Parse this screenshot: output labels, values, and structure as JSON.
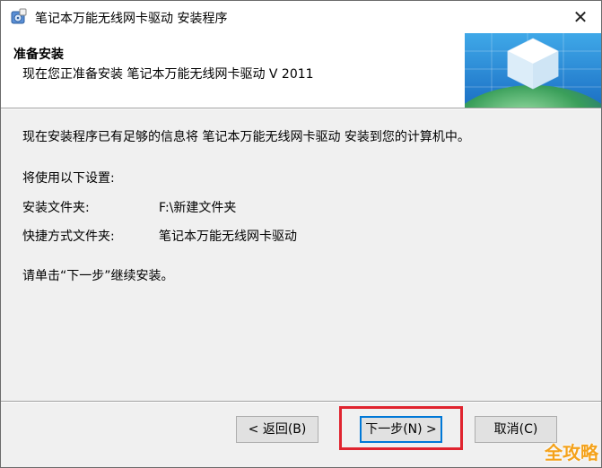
{
  "window": {
    "title": "笔记本万能无线网卡驱动 安装程序",
    "close_glyph": "✕"
  },
  "header": {
    "title": "准备安装",
    "subtitle": "现在您正准备安装 笔记本万能无线网卡驱动 V 2011"
  },
  "content": {
    "intro": "现在安装程序已有足够的信息将 笔记本万能无线网卡驱动 安装到您的计算机中。",
    "settings_heading": "将使用以下设置:",
    "install_folder_label": "安装文件夹:",
    "install_folder_value": "F:\\新建文件夹",
    "shortcut_folder_label": "快捷方式文件夹:",
    "shortcut_folder_value": "笔记本万能无线网卡驱动",
    "instruction": "请单击“下一步”继续安装。"
  },
  "buttons": {
    "back": "< 返回(B)",
    "next": "下一步(N) >",
    "cancel": "取消(C)"
  },
  "watermark": "全攻略",
  "colors": {
    "highlight": "#e0242f",
    "watermark": "#f4a21b",
    "primary_border": "#0078d7"
  }
}
